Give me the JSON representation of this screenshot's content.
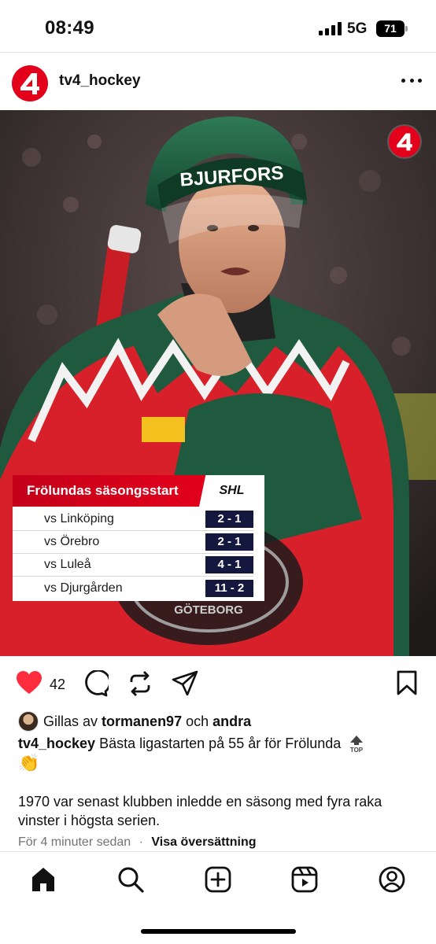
{
  "status_bar": {
    "time": "08:49",
    "network": "5G",
    "battery": "71"
  },
  "post": {
    "username": "tv4_hockey",
    "likes": "42",
    "liked_by": {
      "prefix": "Gillas av",
      "user": "tormanen97",
      "connector": "och",
      "others": "andra"
    },
    "caption_user": "tv4_hockey",
    "caption_text": "Bästa ligastarten på 55 år för Frölunda",
    "emoji_top": "TOP",
    "emoji_clap": "👏",
    "body_text": "1970 var senast klubben inledde en säsong med fyra raka vinster i högsta serien.",
    "timestamp": "För 4 minuter sedan",
    "separator": "·",
    "translate_label": "Visa översättning"
  },
  "image": {
    "helmet_text": "BJURFORS",
    "logo_text": "4",
    "results": {
      "title": "Frölundas säsongsstart",
      "league": "SHL",
      "games": [
        {
          "team": "vs Linköping",
          "score": "2 - 1"
        },
        {
          "team": "vs Örebro",
          "score": "2 - 1"
        },
        {
          "team": "vs Luleå",
          "score": "4 - 1"
        },
        {
          "team": "vs Djurgården",
          "score": "11 - 2"
        }
      ]
    }
  },
  "colors": {
    "tv4_red": "#e3001b",
    "like_red": "#ff2d3d",
    "score_navy": "#15183e",
    "jersey_green": "#1f5a3e"
  },
  "icons": {
    "like": "heart-icon",
    "comment": "comment-icon",
    "repost": "repost-icon",
    "share": "share-icon",
    "save": "bookmark-icon",
    "more": "more-icon",
    "nav": [
      "home-icon",
      "search-icon",
      "create-icon",
      "reels-icon",
      "profile-icon"
    ]
  }
}
